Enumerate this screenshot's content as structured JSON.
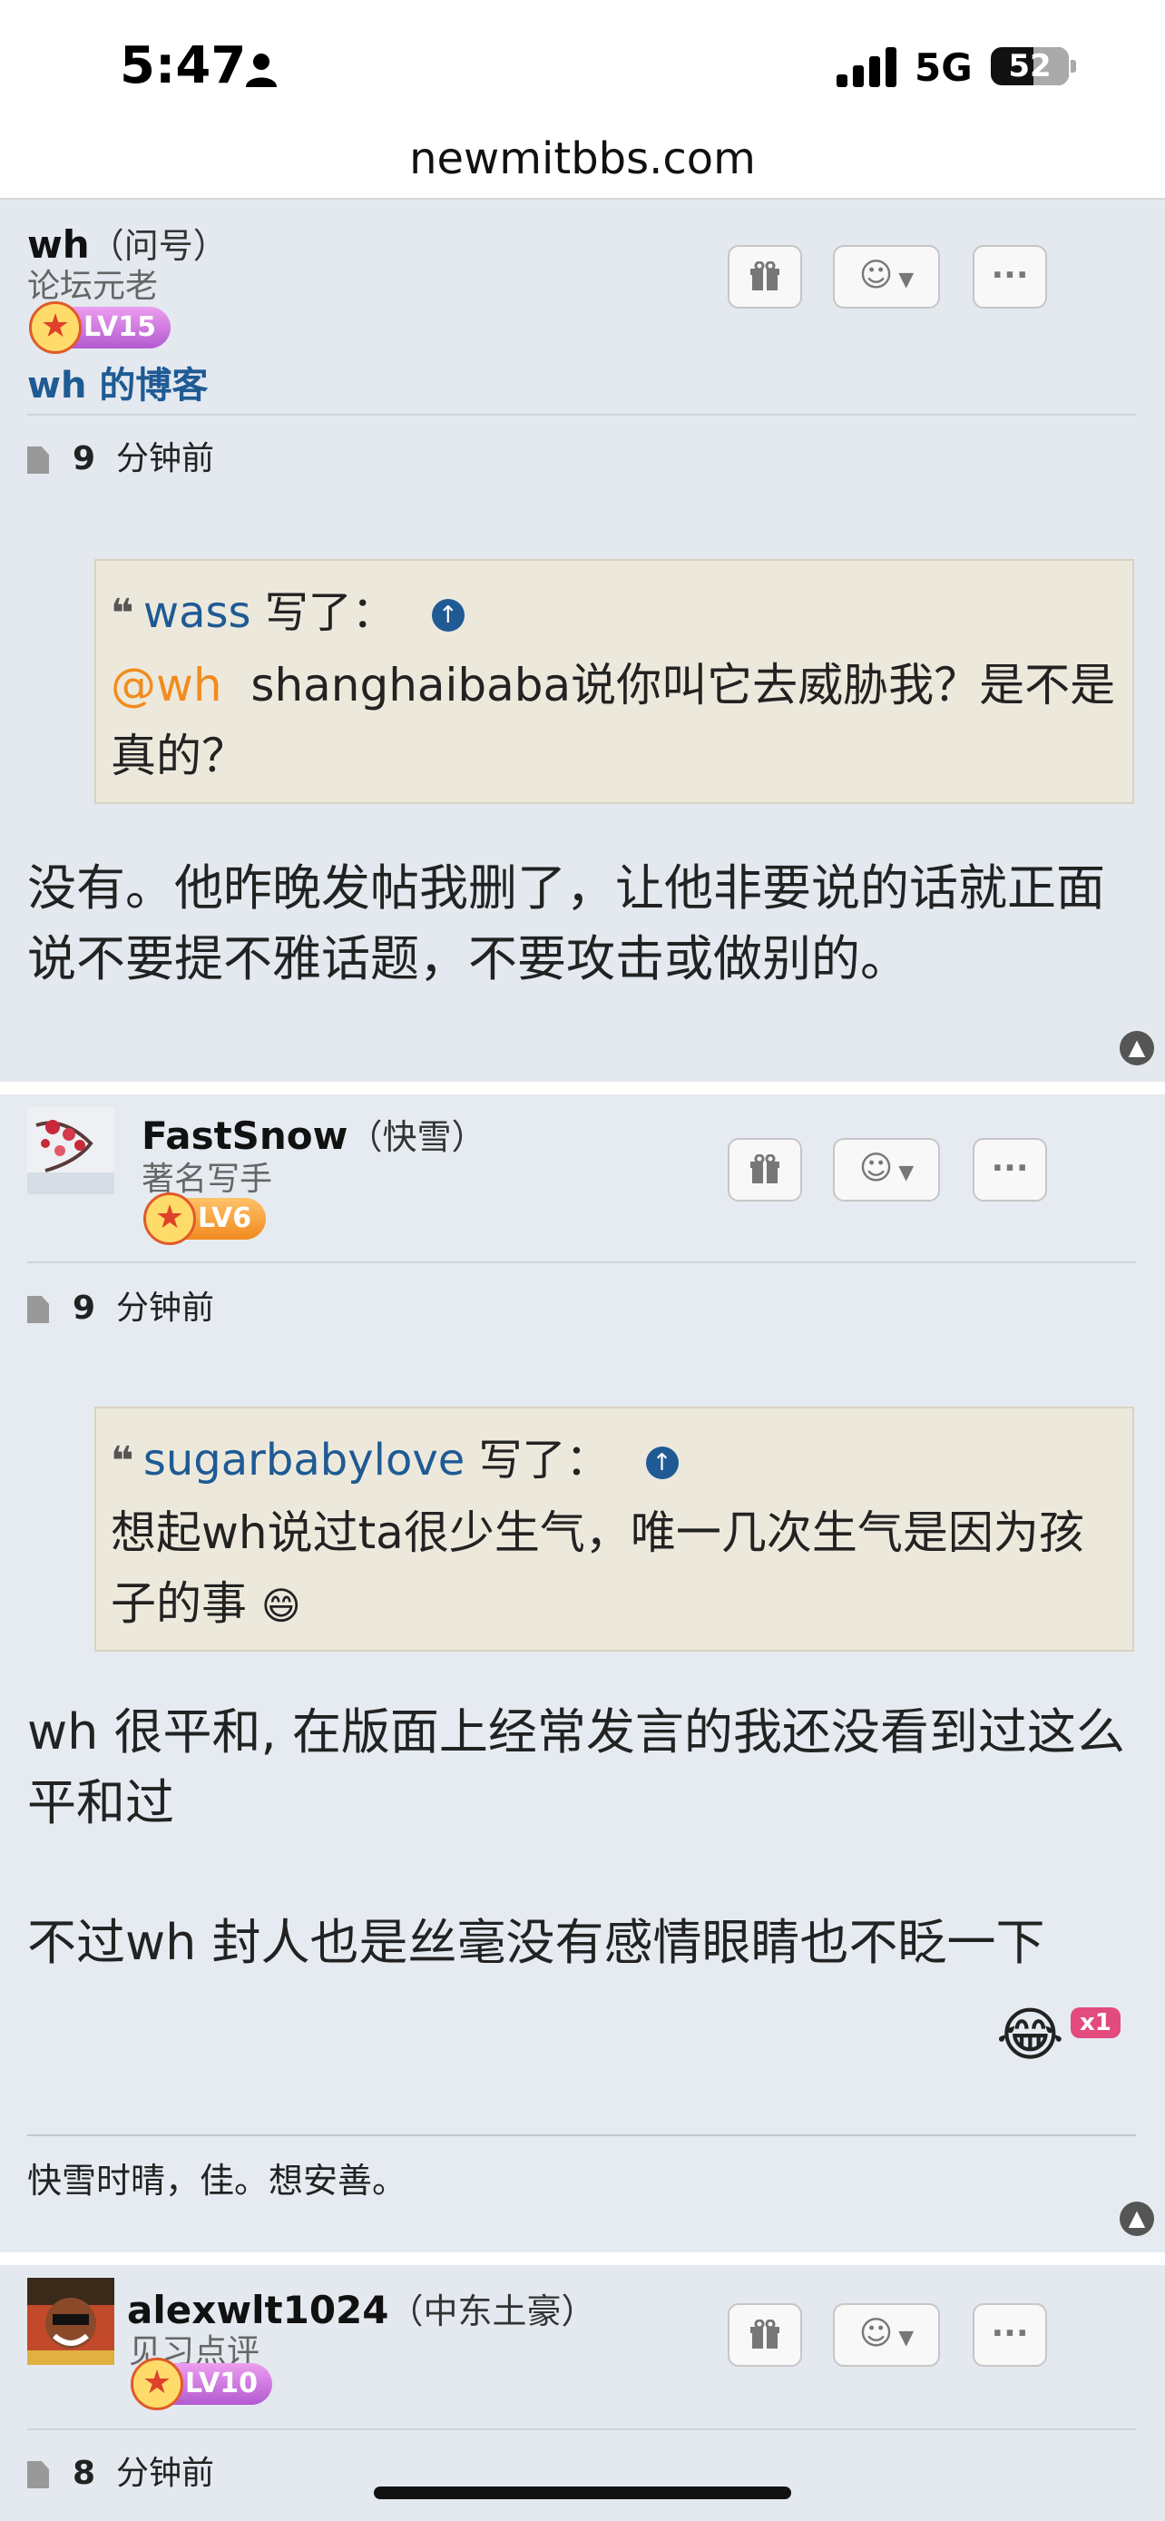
{
  "status": {
    "time": "5:47",
    "network": "5G",
    "battery": "52"
  },
  "browser": {
    "url": "newmitbbs.com"
  },
  "posts": [
    {
      "username": "wh",
      "nickname": "（问号）",
      "rank": "论坛元老",
      "level": "LV15",
      "blog": "wh 的博客",
      "floor": "9",
      "time": "分钟前",
      "quote_user": "wass",
      "quote_wrote": " 写了：",
      "quote_mention": "@wh",
      "quote_text": "shanghaibaba说你叫它去威胁我？是不是真的？",
      "body": "没有。他昨晚发帖我删了，让他非要说的话就正面说不要提不雅话题，不要攻击或做别的。"
    },
    {
      "username": "FastSnow",
      "nickname": "（快雪）",
      "rank": "著名写手",
      "level": "LV6",
      "floor": "9",
      "time": "分钟前",
      "quote_user": "sugarbabylove",
      "quote_wrote": " 写了：",
      "quote_text": "想起wh说过ta很少生气，唯一几次生气是因为孩子的事",
      "quote_emoji": "😄",
      "body1": "wh 很平和, 在版面上经常发言的我还没看到过这么平和过",
      "body2": "不过wh 封人也是丝毫没有感情眼睛也不眨一下",
      "reaction_emoji": "😂",
      "reaction_count": "x1",
      "signature": "快雪时晴，佳。想安善。"
    },
    {
      "username": "alexwlt1024",
      "nickname": "（中东土豪）",
      "rank": "见习点评",
      "level": "LV10",
      "floor": "8",
      "time": "分钟前"
    }
  ],
  "icons": {
    "gift": "gift-icon",
    "emoji": "smiley-icon",
    "more": "more-icon",
    "top": "scroll-top-icon"
  }
}
